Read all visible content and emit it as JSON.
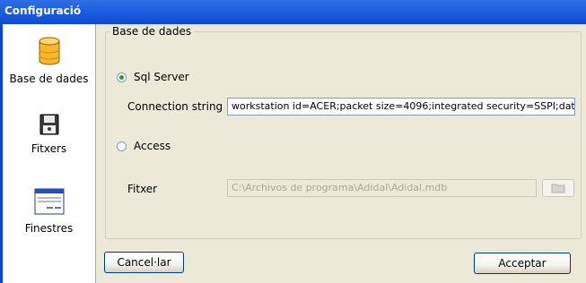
{
  "window": {
    "title": "Configuració"
  },
  "sidebar": {
    "items": [
      {
        "label": "Base de dades",
        "icon": "database-icon"
      },
      {
        "label": "Fitxers",
        "icon": "floppy-disk-icon"
      },
      {
        "label": "Finestres",
        "icon": "window-icon"
      }
    ]
  },
  "database": {
    "group_title": "Base de dades",
    "sql_server_label": "Sql Server",
    "sql_server_selected": true,
    "connection_string_label": "Connection string",
    "connection_string_value": "workstation id=ACER;packet size=4096;integrated security=SSPI;data s",
    "access_label": "Access",
    "access_selected": false,
    "file_label": "Fitxer",
    "file_value": "C:\\Archivos de programa\\Adidal\\Adidal.mdb"
  },
  "buttons": {
    "cancel": "Cancel·lar",
    "accept": "Acceptar"
  },
  "colors": {
    "titlebar": "#0f4ad0",
    "radio_dot": "#21a121",
    "database_icon": "#f7b728"
  }
}
